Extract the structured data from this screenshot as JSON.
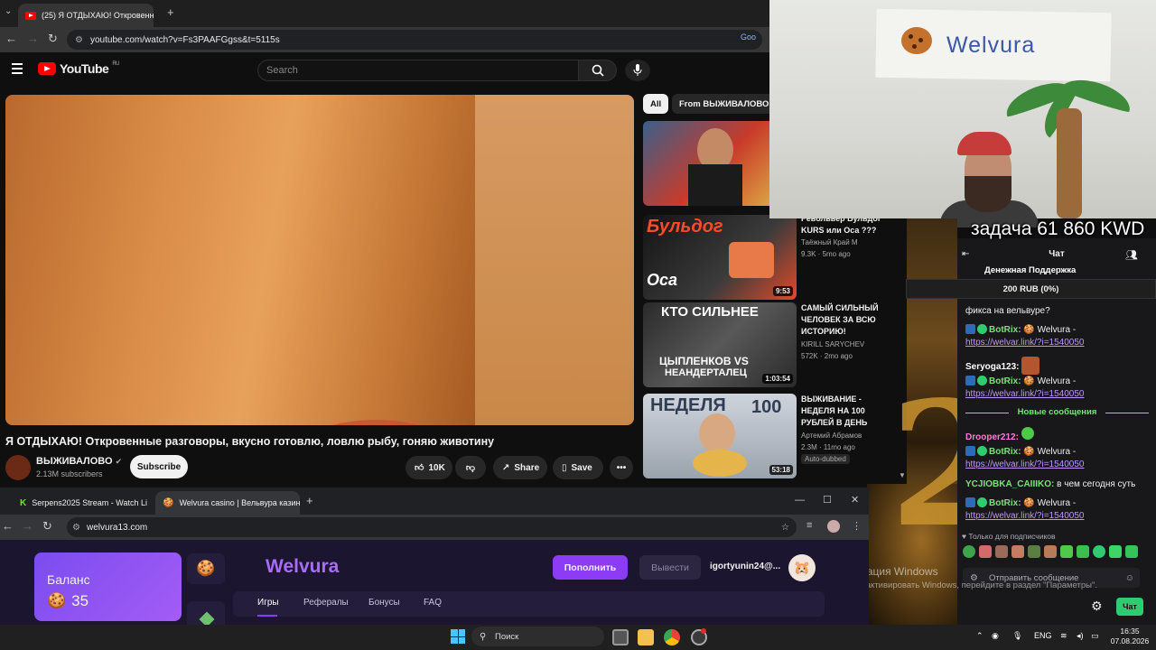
{
  "top_browser": {
    "tab_title": "(25) Я ОТДЫХАЮ! Откровенн",
    "url": "youtube.com/watch?v=Fs3PAAFGgss&t=5115s",
    "partial_right": "Goo"
  },
  "youtube": {
    "logo": "YouTube",
    "region": "RU",
    "search_placeholder": "Search",
    "video_title": "Я ОТДЫХАЮ! Откровенные разговоры, вкусно готовлю, ловлю рыбу, гоняю животину",
    "channel_name": "ВЫЖИВАЛОВО",
    "subscribers": "2.13M subscribers",
    "subscribe_label": "Subscribe",
    "likes": "10K",
    "share_label": "Share",
    "save_label": "Save",
    "chips": [
      "All",
      "From ВЫЖИВАЛОВО"
    ],
    "recommendations": [
      {
        "thumb_text": "",
        "duration": "",
        "title": "",
        "channel": "",
        "meta": ""
      },
      {
        "thumb_text": "Бульдог / Оса",
        "duration": "9:53",
        "title": "Револьвер Бульдог KURS или Оса ???",
        "channel": "Таёжный Край М",
        "meta": "9.3K · 5mo ago"
      },
      {
        "thumb_text": "КТО СИЛЬНЕЕ / ЦЫПЛЕНКОВ VS НЕАНДЕРТАЛЕЦ",
        "duration": "1:03:54",
        "title": "САМЫЙ СИЛЬНЫЙ ЧЕЛОВЕК ЗА ВСЮ ИСТОРИЮ!",
        "channel": "KIRILL SARYCHEV",
        "meta": "572K · 2mo ago"
      },
      {
        "thumb_text": "НЕДЕЛЯ НА 100",
        "duration": "53:18",
        "title": "ВЫЖИВАНИЕ - НЕДЕЛЯ НА 100 РУБЛЕЙ В ДЕНЬ",
        "channel": "Артемий Абрамов",
        "meta": "2.3M · 11mo ago",
        "badge": "Auto-dubbed"
      }
    ]
  },
  "webcam": {
    "sign_text": "Welvura"
  },
  "overlay": {
    "task": "задача 61 860 KWD",
    "donation_title": "Денежная  Поддержка",
    "donation_amount": "200 RUB (0%)"
  },
  "chat": {
    "header": "Чат",
    "messages": [
      {
        "user": "",
        "text": "фикса на вельвуре?",
        "kind": "plain"
      },
      {
        "user": "BotRix:",
        "text": "🍪 Welvura -",
        "link": "https://welvar.link/?i=1540050",
        "kind": "bot"
      },
      {
        "user": "Seryoga123:",
        "text": "",
        "kind": "user"
      },
      {
        "user": "BotRix:",
        "text": "🍪 Welvura -",
        "link": "https://welvar.link/?i=1540050",
        "kind": "bot"
      }
    ],
    "new_messages": "Новые сообщения",
    "messages_after": [
      {
        "user": "Drooper212:",
        "text": "",
        "kind": "user"
      },
      {
        "user": "BotRix:",
        "text": "🍪 Welvura -",
        "link": "https://welvar.link/?i=1540050",
        "kind": "bot"
      },
      {
        "user": "YCJIOBKA_CAIIIKO:",
        "text": "в чем сегодня суть",
        "kind": "user"
      },
      {
        "user": "BotRix:",
        "text": "🍪 Welvura -",
        "link": "https://welvar.link/?i=1540050",
        "kind": "bot"
      }
    ],
    "subscribers_only": "Только для подписчиков",
    "input_placeholder": "Отправить сообщение",
    "send_label": "Чат"
  },
  "windows_activation": {
    "line1": "Активация Windows",
    "line2": "Чтобы активировать Windows, перейдите в раздел \"Параметры\"."
  },
  "bottom_browser": {
    "tabs": [
      "Serpens2025 Stream - Watch Li",
      "Welvura casino | Вельвура казин"
    ],
    "url": "welvura13.com"
  },
  "casino": {
    "balance_label": "Баланс",
    "balance_value": "35",
    "brand": "Welvura",
    "deposit_label": "Пополнить",
    "withdraw_label": "Вывести",
    "username": "igortyunin24@...",
    "nav": [
      "Игры",
      "Рефералы",
      "Бонусы",
      "FAQ"
    ]
  },
  "taskbar": {
    "search_label": "Поиск",
    "lang": "ENG",
    "time": "16:35",
    "date": "07.08.2026"
  }
}
